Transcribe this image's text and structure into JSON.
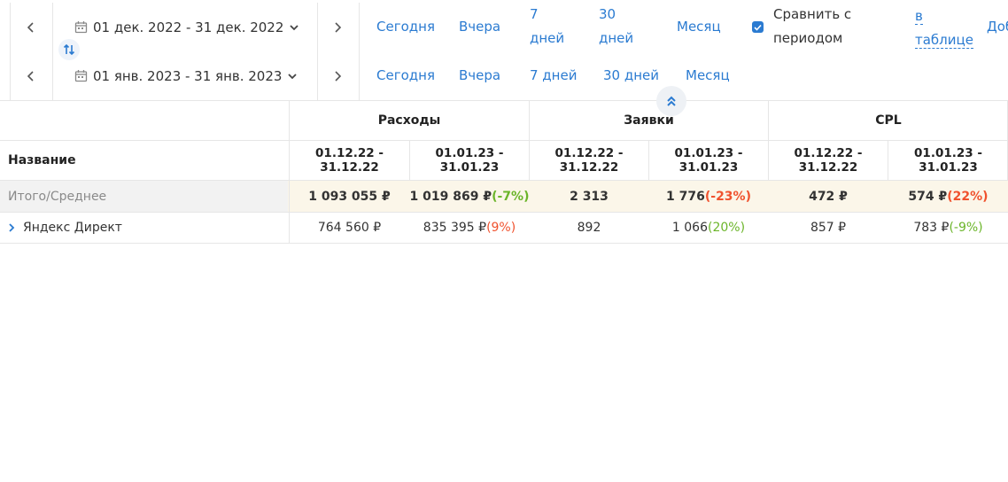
{
  "period1": {
    "range": "01 дек. 2022 - 31 дек. 2022",
    "quick": {
      "today": "Сегодня",
      "yesterday": "Вчера",
      "d7_a": "7",
      "d7_b": "дней",
      "d30_a": "30",
      "d30_b": "дней",
      "month": "Месяц"
    },
    "compare": {
      "line1": "Сравнить с",
      "line2": "периодом"
    },
    "in_table": {
      "line1": "в",
      "line2": "таблице"
    },
    "add_partial": "Доб"
  },
  "period2": {
    "range": "01 янв. 2023 - 31 янв. 2023",
    "quick": {
      "today": "Сегодня",
      "yesterday": "Вчера",
      "d7": "7 дней",
      "d30": "30 дней",
      "month": "Месяц"
    }
  },
  "colors": {
    "accent": "#2b7bd1",
    "negative": "#f0522e",
    "positive": "#6bb52a",
    "total_bg": "#fbf6e9",
    "total_name_bg": "#f2f2f2"
  },
  "table": {
    "name_header": "Название",
    "groups": [
      "Расходы",
      "Заявки",
      "CPL"
    ],
    "periods": [
      {
        "line1": "01.12.22 -",
        "line2": "31.12.22"
      },
      {
        "line1": "01.01.23 -",
        "line2": "31.01.23"
      }
    ],
    "total": {
      "name": "Итого/Среднее",
      "cells": [
        {
          "value": "1 093 055 ₽",
          "delta": ""
        },
        {
          "value": "1 019 869 ₽",
          "delta": "(-7%)"
        },
        {
          "value": "2 313",
          "delta": ""
        },
        {
          "value": "1 776",
          "delta": "(-23%)"
        },
        {
          "value": "472 ₽",
          "delta": ""
        },
        {
          "value": "574 ₽",
          "delta": "(22%)"
        }
      ]
    },
    "rows": [
      {
        "name": "Яндекс Директ",
        "cells": [
          {
            "value": "764 560 ₽",
            "delta": ""
          },
          {
            "value": "835 395 ₽",
            "delta": "(9%)"
          },
          {
            "value": "892",
            "delta": ""
          },
          {
            "value": "1 066",
            "delta": "(20%)"
          },
          {
            "value": "857 ₽",
            "delta": ""
          },
          {
            "value": "783 ₽",
            "delta": "(-9%)"
          }
        ]
      }
    ]
  },
  "icons": {
    "prev": "chevron-left-icon",
    "next": "chevron-right-icon",
    "calendar": "calendar-icon",
    "dropdown": "chevron-down-icon",
    "swap": "swap-arrows-icon",
    "collapse": "double-chevron-up-icon",
    "expand_row": "chevron-right-icon",
    "checkbox": "check-icon"
  }
}
